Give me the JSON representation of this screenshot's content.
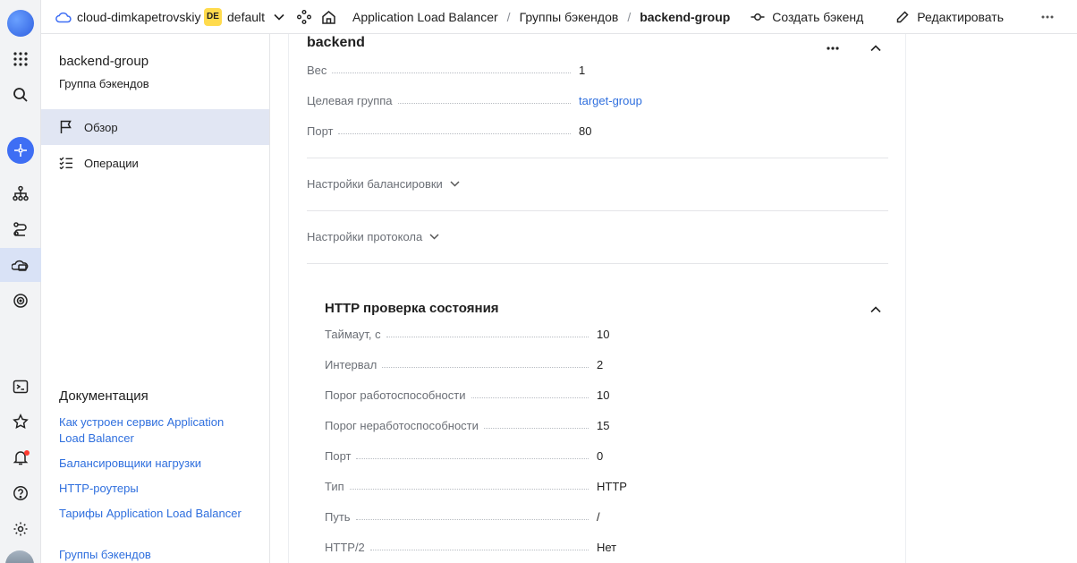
{
  "topbar": {
    "cloud_name": "cloud-dimkapetrovskiy",
    "folder_badge": "DE",
    "folder_name": "default",
    "breadcrumbs": [
      "Application Load Balancer",
      "Группы бэкендов",
      "backend-group"
    ],
    "create_label": "Создать бэкенд",
    "edit_label": "Редактировать"
  },
  "sidebar": {
    "title": "backend-group",
    "subtitle": "Группа бэкендов",
    "nav": [
      {
        "label": "Обзор",
        "icon": "flag-icon",
        "active": true
      },
      {
        "label": "Операции",
        "icon": "checklist-icon",
        "active": false
      }
    ],
    "docs_title": "Документация",
    "docs_links": [
      "Как устроен сервис Application Load Balancer",
      "Балансировщики нагрузки",
      "HTTP-роутеры",
      "Тарифы Application Load Balancer",
      "Группы бэкендов"
    ]
  },
  "backend": {
    "title": "backend",
    "fields": [
      {
        "label": "Вес",
        "value": "1"
      },
      {
        "label": "Целевая группа",
        "value": "target-group"
      },
      {
        "label": "Порт",
        "value": "80"
      }
    ],
    "balancing_settings": "Настройки балансировки",
    "protocol_settings": "Настройки протокола"
  },
  "healthcheck": {
    "title": "HTTP проверка состояния",
    "fields": [
      {
        "label": "Таймаут, с",
        "value": "10"
      },
      {
        "label": "Интервал",
        "value": "2"
      },
      {
        "label": "Порог работоспособности",
        "value": "10"
      },
      {
        "label": "Порог неработоспособности",
        "value": "15"
      },
      {
        "label": "Порт",
        "value": "0"
      },
      {
        "label": "Тип",
        "value": "HTTP"
      },
      {
        "label": "Путь",
        "value": "/"
      },
      {
        "label": "HTTP/2",
        "value": "Нет"
      }
    ]
  },
  "colors": {
    "accent": "#3e6ef4",
    "link": "#2f6fde",
    "active_nav": "#e1e6f3",
    "badge": "#ffdb4d"
  }
}
